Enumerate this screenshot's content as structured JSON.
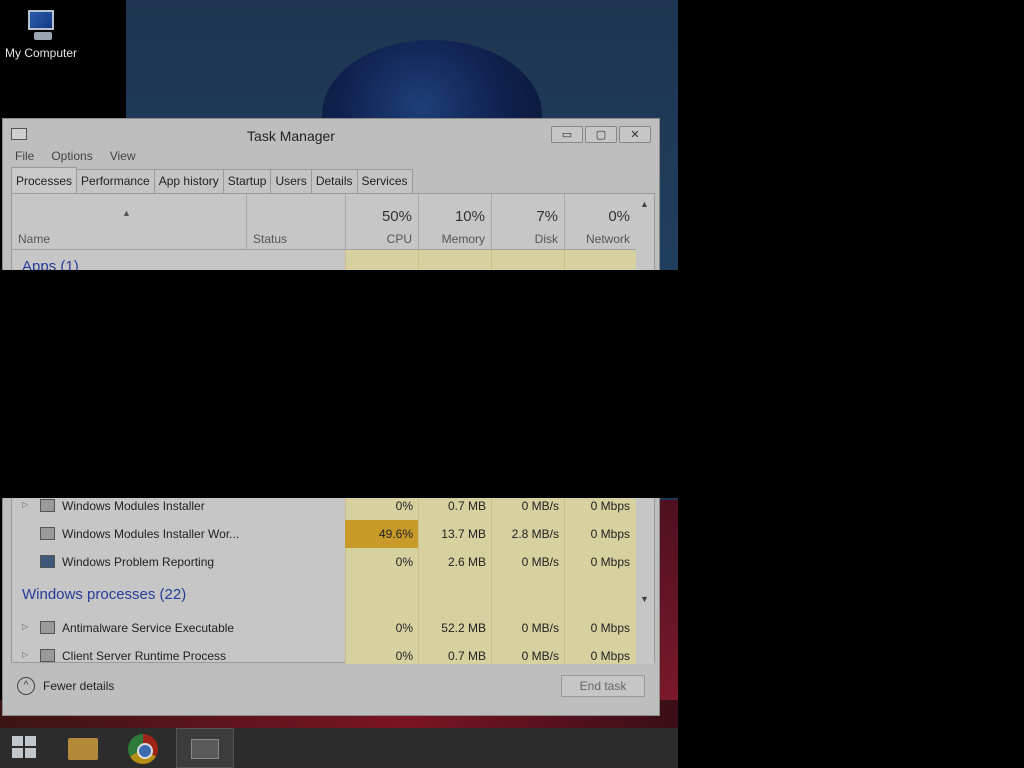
{
  "desktop": {
    "icons": [
      {
        "label": "My Computer",
        "icon": "computer-icon"
      }
    ]
  },
  "window": {
    "title": "Task Manager",
    "controls": {
      "minimize": "▭",
      "maximize": "▢",
      "close": "✕"
    },
    "menu": [
      "File",
      "Options",
      "View"
    ],
    "tabs": [
      "Processes",
      "Performance",
      "App history",
      "Startup",
      "Users",
      "Details",
      "Services"
    ],
    "active_tab": "Processes"
  },
  "columns": {
    "name": "Name",
    "status": "Status",
    "cpu": {
      "pct": "50%",
      "label": "CPU"
    },
    "memory": {
      "pct": "10%",
      "label": "Memory"
    },
    "disk": {
      "pct": "7%",
      "label": "Disk"
    },
    "network": {
      "pct": "0%",
      "label": "Network"
    }
  },
  "groups": {
    "apps": "Apps (1)",
    "windows_processes": "Windows processes (22)"
  },
  "rows": [
    {
      "name": "Windows Modules Installer",
      "expand": "▷",
      "cpu": "0%",
      "memory": "0.7 MB",
      "disk": "0 MB/s",
      "network": "0 Mbps"
    },
    {
      "name": "Windows Modules Installer Wor...",
      "expand": "",
      "cpu": "49.6%",
      "memory": "13.7 MB",
      "disk": "2.8 MB/s",
      "network": "0 Mbps"
    },
    {
      "name": "Windows Problem Reporting",
      "expand": "",
      "cpu": "0%",
      "memory": "2.6 MB",
      "disk": "0 MB/s",
      "network": "0 Mbps"
    },
    {
      "name": "Antimalware Service Executable",
      "expand": "▷",
      "cpu": "0%",
      "memory": "52.2 MB",
      "disk": "0 MB/s",
      "network": "0 Mbps"
    },
    {
      "name": "Client Server Runtime Process",
      "expand": "▷",
      "cpu": "0%",
      "memory": "0.7 MB",
      "disk": "0 MB/s",
      "network": "0 Mbps"
    }
  ],
  "footer": {
    "fewer_details": "Fewer details",
    "end_task": "End task"
  },
  "taskbar": {
    "items": [
      "windows-start-icon",
      "file-explorer-icon",
      "chrome-icon",
      "task-manager-icon"
    ]
  },
  "colors": {
    "highlight_cpu": "#c89a2a",
    "column_tint": "#d7d1a0",
    "group_text": "#243d99"
  }
}
